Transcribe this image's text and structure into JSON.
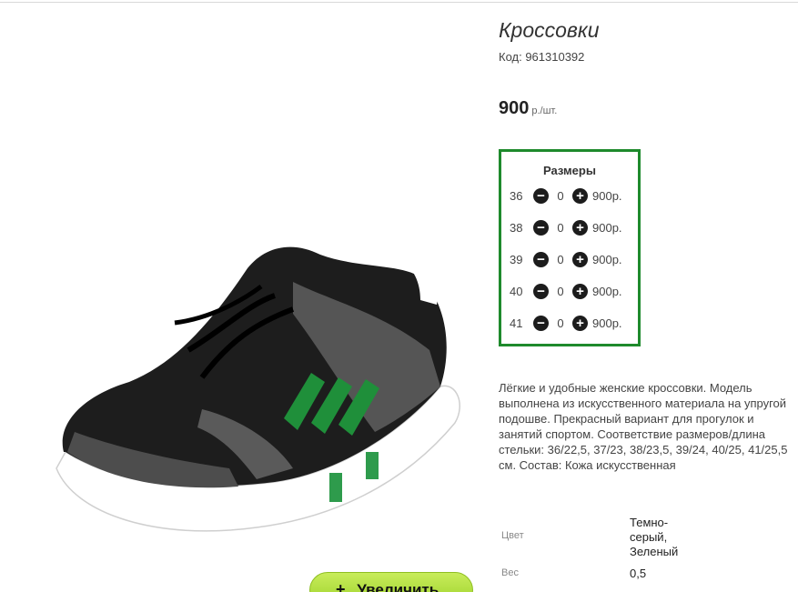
{
  "product": {
    "title": "Кроссовки",
    "code": "Код: 961310392",
    "price": "900",
    "price_unit": "р./шт."
  },
  "sizes": {
    "title": "Размеры",
    "rows": [
      {
        "size": "36",
        "qty": "0",
        "price": "900р."
      },
      {
        "size": "38",
        "qty": "0",
        "price": "900р."
      },
      {
        "size": "39",
        "qty": "0",
        "price": "900р."
      },
      {
        "size": "40",
        "qty": "0",
        "price": "900р."
      },
      {
        "size": "41",
        "qty": "0",
        "price": "900р."
      }
    ]
  },
  "description": "Лёгкие и удобные женские кроссовки. Модель выполнена из искусственного материала на упругой подошве. Прекрасный вариант для прогулок и занятий спортом. Соответствие размеров/длина стельки: 36/22,5, 37/23, 38/23,5, 39/24, 40/25, 41/25,5 см. Состав: Кожа искусственная",
  "attributes": [
    {
      "label": "Цвет",
      "value": "Темно-серый, Зеленый"
    },
    {
      "label": "Вес",
      "value": "0,5"
    }
  ],
  "zoom": {
    "icon": "plus-icon",
    "label": "Увеличить"
  },
  "colors": {
    "accent_border": "#1e8a2c",
    "button": "#9bd12a"
  }
}
